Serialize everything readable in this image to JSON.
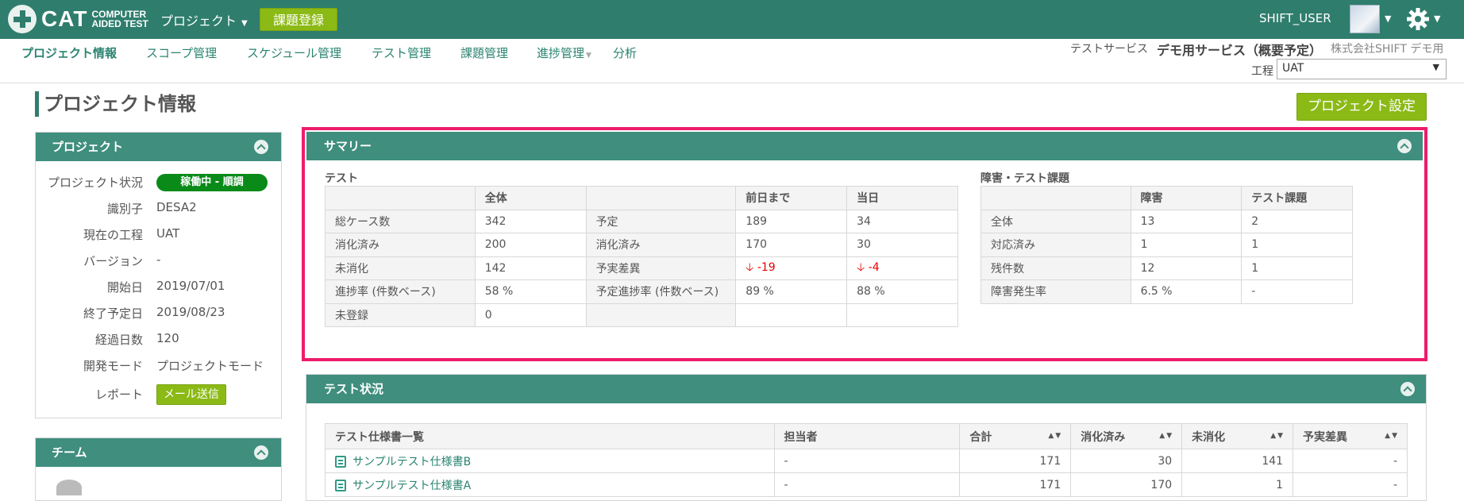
{
  "header": {
    "logo_main": "CAT",
    "logo_sub1": "COMPUTER",
    "logo_sub2": "AIDED TEST",
    "project_menu": "プロジェクト",
    "register_button": "課題登録",
    "user_name": "SHIFT_USER"
  },
  "subnav": {
    "items": [
      "プロジェクト情報",
      "スコープ管理",
      "スケジュール管理",
      "テスト管理",
      "課題管理",
      "進捗管理",
      "分析"
    ],
    "service_label": "テストサービス",
    "service_name": "デモ用サービス（概要予定）",
    "company": "株式会社SHIFT デモ用",
    "process_label": "工程",
    "process_value": "UAT"
  },
  "page": {
    "title": "プロジェクト情報",
    "settings_button": "プロジェクト設定"
  },
  "project_panel": {
    "title": "プロジェクト",
    "rows": [
      {
        "label": "プロジェクト状況",
        "value": "稼働中 - 順調"
      },
      {
        "label": "識別子",
        "value": "DESA2"
      },
      {
        "label": "現在の工程",
        "value": "UAT"
      },
      {
        "label": "バージョン",
        "value": "-"
      },
      {
        "label": "開始日",
        "value": "2019/07/01"
      },
      {
        "label": "終了予定日",
        "value": "2019/08/23"
      },
      {
        "label": "経過日数",
        "value": "120"
      },
      {
        "label": "開発モード",
        "value": "プロジェクトモード"
      },
      {
        "label": "レポート",
        "value": "メール送信"
      }
    ]
  },
  "team_panel": {
    "title": "チーム"
  },
  "summary": {
    "title": "サマリー",
    "test": {
      "title": "テスト",
      "headers": [
        "",
        "全体",
        "",
        "前日まで",
        "当日"
      ],
      "rows": [
        [
          "総ケース数",
          "342",
          "予定",
          "189",
          "34"
        ],
        [
          "消化済み",
          "200",
          "消化済み",
          "170",
          "30"
        ],
        [
          "未消化",
          "142",
          "予実差異",
          "-19",
          "-4"
        ],
        [
          "進捗率 (件数ベース)",
          "58 %",
          "予定進捗率 (件数ベース)",
          "89 %",
          "88 %"
        ],
        [
          "未登録",
          "0",
          "",
          "",
          ""
        ]
      ]
    },
    "defects": {
      "title": "障害・テスト課題",
      "headers": [
        "",
        "障害",
        "テスト課題"
      ],
      "rows": [
        [
          "全体",
          "13",
          "2"
        ],
        [
          "対応済み",
          "1",
          "1"
        ],
        [
          "残件数",
          "12",
          "1"
        ],
        [
          "障害発生率",
          "6.5 %",
          "-"
        ]
      ]
    }
  },
  "test_status": {
    "title": "テスト状況",
    "headers": [
      "テスト仕様書一覧",
      "担当者",
      "合計",
      "消化済み",
      "未消化",
      "予実差異"
    ],
    "rows": [
      [
        "サンプルテスト仕様書B",
        "-",
        "171",
        "30",
        "141",
        "-"
      ],
      [
        "サンプルテスト仕様書A",
        "-",
        "171",
        "170",
        "1",
        "-"
      ]
    ]
  },
  "colors": {
    "header_bg": "#2f7d6d",
    "panel_head_bg": "#3f8e7e",
    "accent_green": "#8bba16",
    "highlight_border": "#ee1c6b",
    "negative": "#e60000"
  }
}
